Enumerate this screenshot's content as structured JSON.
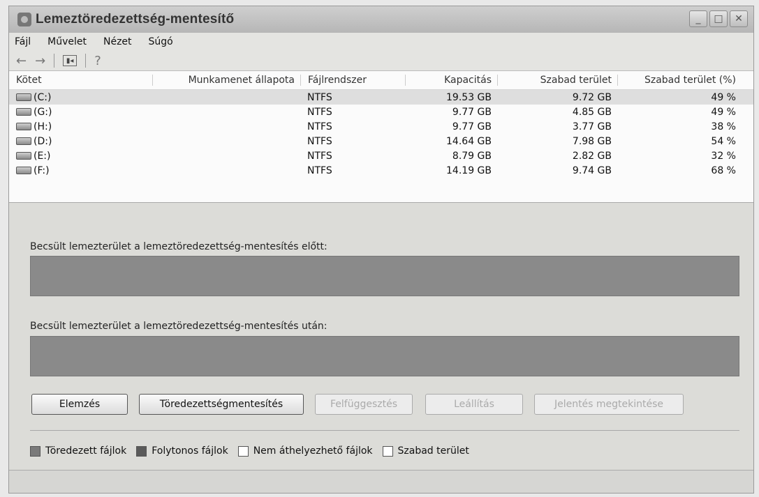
{
  "window": {
    "title": "Lemeztöredezettség-mentesítő"
  },
  "menu": [
    "Fájl",
    "Művelet",
    "Nézet",
    "Súgó"
  ],
  "list": {
    "columns": [
      "Kötet",
      "Munkamenet állapota",
      "Fájlrendszer",
      "Kapacitás",
      "Szabad terület",
      "Szabad terület (%)"
    ],
    "rows": [
      {
        "volume": "(C:)",
        "status": "",
        "fs": "NTFS",
        "capacity": "19.53 GB",
        "free": "9.72 GB",
        "pct": "49 %"
      },
      {
        "volume": "(G:)",
        "status": "",
        "fs": "NTFS",
        "capacity": "9.77 GB",
        "free": "4.85 GB",
        "pct": "49 %"
      },
      {
        "volume": "(H:)",
        "status": "",
        "fs": "NTFS",
        "capacity": "9.77 GB",
        "free": "3.77 GB",
        "pct": "38 %"
      },
      {
        "volume": "(D:)",
        "status": "",
        "fs": "NTFS",
        "capacity": "14.64 GB",
        "free": "7.98 GB",
        "pct": "54 %"
      },
      {
        "volume": "(E:)",
        "status": "",
        "fs": "NTFS",
        "capacity": "8.79 GB",
        "free": "2.82 GB",
        "pct": "32 %"
      },
      {
        "volume": "(F:)",
        "status": "",
        "fs": "NTFS",
        "capacity": "14.19 GB",
        "free": "9.74 GB",
        "pct": "68 %"
      }
    ]
  },
  "analysis": {
    "before_label": "Becsült lemezterület a lemeztöredezettség-mentesítés előtt:",
    "after_label": "Becsült lemezterület a lemeztöredezettség-mentesítés után:"
  },
  "buttons": {
    "analyze": "Elemzés",
    "defragment": "Töredezettségmentesítés",
    "pause": "Felfüggesztés",
    "stop": "Leállítás",
    "view_report": "Jelentés megtekintése"
  },
  "legend": [
    {
      "label": "Töredezett fájlok",
      "color": "#7a7a7a"
    },
    {
      "label": "Folytonos fájlok",
      "color": "#5a5a5a"
    },
    {
      "label": "Nem áthelyezhető fájlok",
      "color": "#ffffff"
    },
    {
      "label": "Szabad terület",
      "color": "#ffffff"
    }
  ],
  "icons": [
    "app-icon",
    "back-arrow-icon",
    "forward-arrow-icon",
    "show-hide-console-icon",
    "help-icon",
    "minimize-icon",
    "maximize-icon",
    "close-icon",
    "drive-icon"
  ]
}
